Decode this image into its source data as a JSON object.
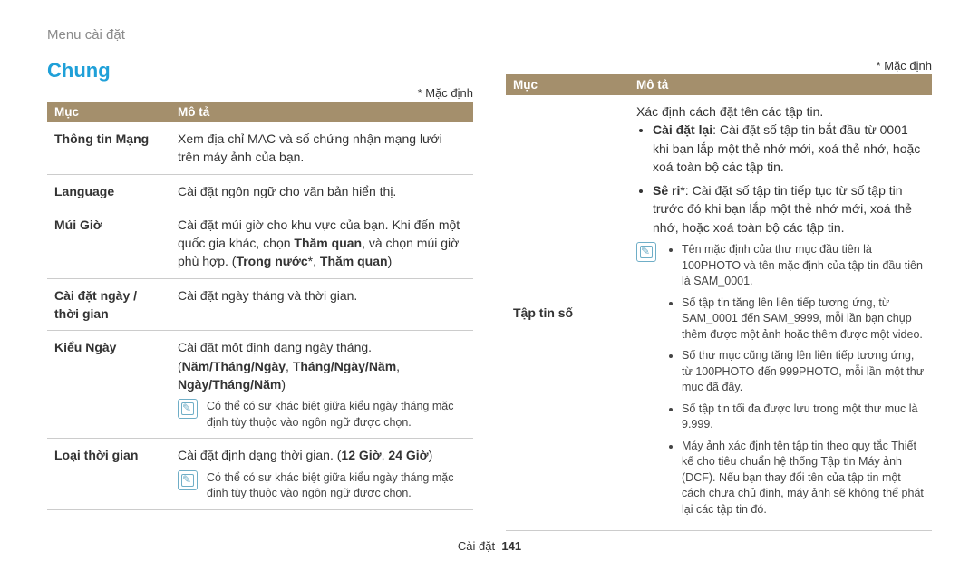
{
  "breadcrumb": "Menu cài đặt",
  "section_title": "Chung",
  "default_note": "* Mặc định",
  "table": {
    "col1": "Mục",
    "col2": "Mô tả"
  },
  "left": {
    "network": {
      "label": "Thông tin Mạng",
      "desc": "Xem địa chỉ MAC và số chứng nhận mạng lưới trên máy ảnh của bạn."
    },
    "language": {
      "label": "Language",
      "desc": "Cài đặt ngôn ngữ cho văn bản hiển thị."
    },
    "timezone": {
      "label": "Múi Giờ",
      "desc_pre": "Cài đặt múi giờ cho khu vực của bạn. Khi đến một quốc gia khác, chọn ",
      "bold1": "Thăm quan",
      "mid1": ", và chọn múi giờ phù hợp. (",
      "bold2": "Trong nước",
      "mid2": "*, ",
      "bold3": "Thăm quan",
      "tail": ")"
    },
    "datetime": {
      "label": "Cài đặt ngày / thời gian",
      "desc": "Cài đặt ngày tháng và thời gian."
    },
    "datetype": {
      "label": "Kiểu Ngày",
      "desc_pre": "Cài đặt một định dạng ngày tháng. (",
      "opt1": "Năm/Tháng/Ngày",
      "sep1": ", ",
      "opt2": "Tháng/Ngày/Năm",
      "sep2": ", ",
      "opt3": "Ngày/Tháng/Năm",
      "tail": ")",
      "note": "Có thể có sự khác biệt giữa kiểu ngày tháng mặc định tùy thuộc vào ngôn ngữ được chọn."
    },
    "timetype": {
      "label": "Loại thời gian",
      "desc_pre": "Cài đặt định dạng thời gian. (",
      "opt1": "12 Giờ",
      "sep1": ", ",
      "opt2": "24 Giờ",
      "tail": ")",
      "note": "Có thể có sự khác biệt giữa kiểu ngày tháng mặc định tùy thuộc vào ngôn ngữ được chọn."
    }
  },
  "right": {
    "fileno": {
      "label": "Tập tin số",
      "intro": "Xác định cách đặt tên các tập tin.",
      "reset_label": "Cài đặt lại",
      "reset_text": ": Cài đặt số tập tin bắt đầu từ 0001 khi bạn lắp một thẻ nhớ mới, xoá thẻ nhớ, hoặc xoá toàn bộ các tập tin.",
      "series_label": "Sê ri",
      "series_text": "*: Cài đặt số tập tin tiếp tục từ số tập tin trước đó khi bạn lắp một thẻ nhớ mới, xoá thẻ nhớ, hoặc xoá toàn bộ các tập tin.",
      "note1": "Tên mặc định của thư mục đầu tiên là 100PHOTO và tên mặc định của tập tin đầu tiên là SAM_0001.",
      "note2": "Số tập tin tăng lên liên tiếp tương ứng, từ SAM_0001 đến SAM_9999, mỗi lần bạn chụp thêm được một ảnh hoặc thêm được một video.",
      "note3": "Số thư mục cũng tăng lên liên tiếp tương ứng, từ 100PHOTO đến 999PHOTO, mỗi lần một thư mục đã đầy.",
      "note4": "Số tập tin tối đa được lưu trong một thư mục là 9.999.",
      "note5": "Máy ảnh xác định tên tập tin theo quy tắc Thiết kế cho tiêu chuẩn hệ thống Tập tin Máy ảnh (DCF). Nếu bạn thay đổi tên của tập tin một cách chưa chủ định, máy ảnh sẽ không thể phát lại các tập tin đó."
    }
  },
  "footer": {
    "label": "Cài đặt",
    "page": "141"
  }
}
